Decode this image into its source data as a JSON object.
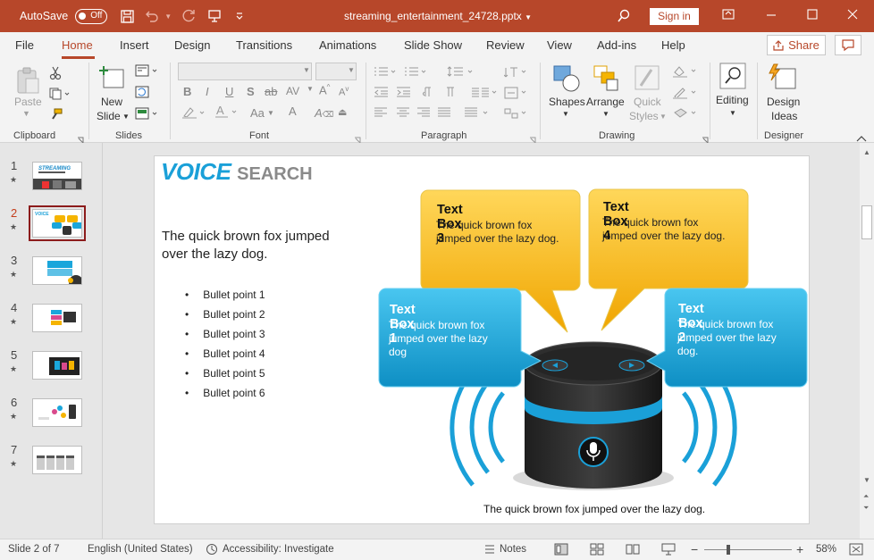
{
  "titlebar": {
    "autosave_label": "AutoSave",
    "autosave_state": "Off",
    "doc_title": "streaming_entertainment_24728.pptx",
    "signin_label": "Sign in",
    "accent_color": "#b7472a"
  },
  "tabs": [
    "File",
    "Home",
    "Insert",
    "Design",
    "Transitions",
    "Animations",
    "Slide Show",
    "Review",
    "View",
    "Add-ins",
    "Help"
  ],
  "active_tab": "Home",
  "share_label": "Share",
  "ribbon": {
    "clipboard": {
      "paste": "Paste",
      "group": "Clipboard"
    },
    "slides": {
      "new_slide_1": "New",
      "new_slide_2": "Slide",
      "group": "Slides"
    },
    "font": {
      "group": "Font"
    },
    "paragraph": {
      "group": "Paragraph"
    },
    "drawing": {
      "shapes": "Shapes",
      "arrange": "Arrange",
      "quick_styles_1": "Quick",
      "quick_styles_2": "Styles",
      "group": "Drawing"
    },
    "editing": {
      "label": "Editing"
    },
    "designer": {
      "design_ideas_1": "Design",
      "design_ideas_2": "Ideas",
      "group": "Designer"
    }
  },
  "thumbnails": [
    {
      "num": "1",
      "star": "★"
    },
    {
      "num": "2",
      "star": "★"
    },
    {
      "num": "3",
      "star": "★"
    },
    {
      "num": "4",
      "star": "★"
    },
    {
      "num": "5",
      "star": "★"
    },
    {
      "num": "6",
      "star": "★"
    },
    {
      "num": "7",
      "star": "★"
    }
  ],
  "slide": {
    "title_main": "VOICE",
    "title_sub": "SEARCH",
    "body": "The quick brown fox jumped over the lazy dog.",
    "bullets": [
      "Bullet point 1",
      "Bullet point 2",
      "Bullet point 3",
      "Bullet point 4",
      "Bullet point 5",
      "Bullet point 6"
    ],
    "boxes": {
      "box1": {
        "title": "Text Box 1",
        "text": "The quick brown fox jumped over the lazy dog"
      },
      "box2": {
        "title": "Text Box 2",
        "text": "The quick brown fox jumped over the lazy dog."
      },
      "box3": {
        "title": "Text Box 3",
        "text": "The quick brown fox jumped over the lazy dog."
      },
      "box4": {
        "title": "Text Box 4",
        "text": "The quick brown fox jumped over the lazy dog."
      }
    },
    "caption": "The quick brown fox jumped over the lazy dog.",
    "colors": {
      "title_blue": "#1aa0d8",
      "box_yellow": "#f5b400",
      "box_blue": "#1aa6db"
    }
  },
  "status": {
    "slide_info": "Slide 2 of 7",
    "language": "English (United States)",
    "accessibility": "Accessibility: Investigate",
    "notes": "Notes",
    "zoom": "58%"
  }
}
